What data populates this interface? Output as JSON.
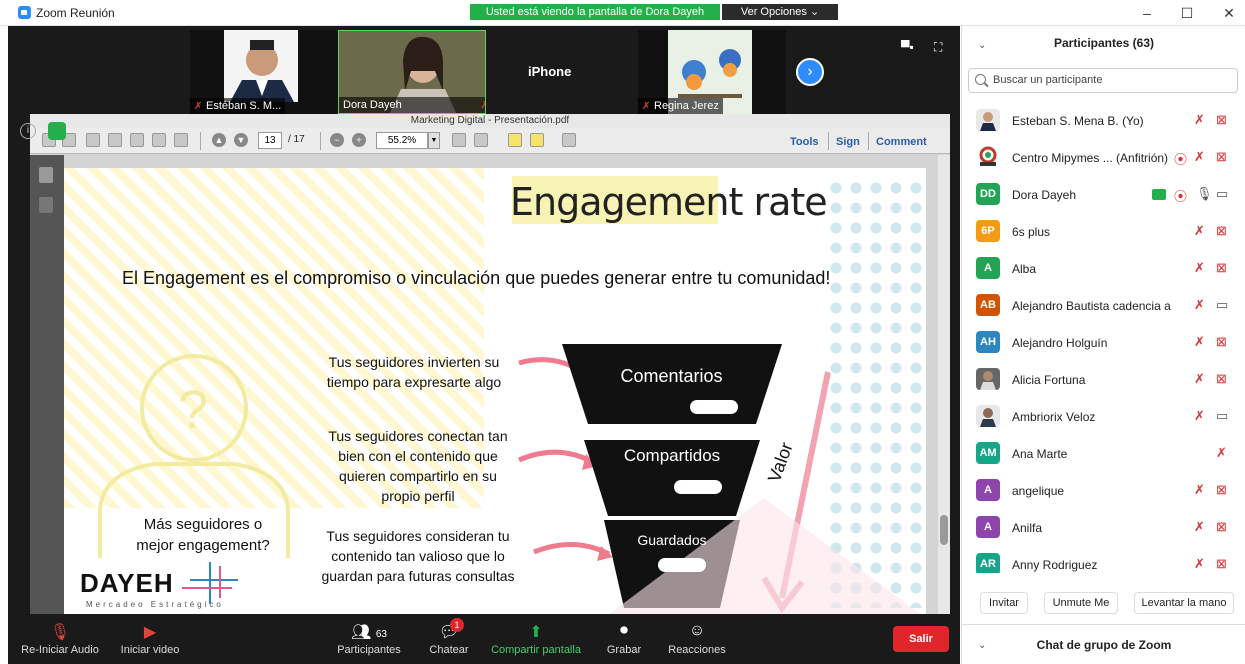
{
  "window": {
    "title": "Zoom Reunión",
    "minimize": "–",
    "maximize": "☐",
    "close": "✕"
  },
  "banner": {
    "text": "Usted está viendo la pantalla de Dora Dayeh",
    "view_options": "Ver Opciones ⌄"
  },
  "video_strip": {
    "tiles": [
      {
        "name": "Estéban S. M..."
      },
      {
        "name": "Dora Dayeh"
      },
      {
        "name": "iPhone"
      },
      {
        "name": "Regina Jerez"
      }
    ]
  },
  "pdf": {
    "title": "Marketing Digital - Presentación.pdf",
    "page": "13",
    "page_total": "/ 17",
    "zoom": "55.2%",
    "tools": "Tools",
    "sign": "Sign",
    "comment": "Comment"
  },
  "slide": {
    "title": "Engagement rate",
    "subtitle": "El Engagement es el compromiso o vinculación que puedes generar entre tu comunidad!",
    "question": "Más seguidores o mejor engagement?",
    "para1": "Tus seguidores invierten su tiempo para expresarte algo",
    "para2": "Tus seguidores conectan tan bien con el contenido que quieren compartirlo en su propio perfil",
    "para3": "Tus seguidores consideran tu contenido tan valioso que lo guardan para futuras consultas",
    "funnel1": "Comentarios",
    "funnel2": "Compartidos",
    "funnel3": "Guardados",
    "valor": "Valor",
    "logo": "DAYEH",
    "logo_sub": "Mercadeo Estratégico"
  },
  "toolbar": {
    "audio": "Re-Iniciar Audio",
    "video": "Iniciar video",
    "participants": "Participantes",
    "participants_count": "63",
    "chat": "Chatear",
    "chat_badge": "1",
    "share": "Compartir pantalla",
    "record": "Grabar",
    "reactions": "Reacciones",
    "exit": "Salir"
  },
  "panel": {
    "header": "Participantes (63)",
    "search_placeholder": "Buscar un participante",
    "participants": [
      {
        "name": "Esteban S. Mena B. (Yo)",
        "initials": "",
        "color": "#555555"
      },
      {
        "name": "Centro Mipymes ... (Anfitrión)",
        "initials": "",
        "color": "#c0392b"
      },
      {
        "name": "Dora Dayeh",
        "initials": "DD",
        "color": "#23a455"
      },
      {
        "name": "6s plus",
        "initials": "6P",
        "color": "#f39c12"
      },
      {
        "name": "Alba",
        "initials": "A",
        "color": "#23a455"
      },
      {
        "name": "Alejandro Bautista cadencia a",
        "initials": "AB",
        "color": "#d35400"
      },
      {
        "name": "Alejandro Holguín",
        "initials": "AH",
        "color": "#2e86c1"
      },
      {
        "name": "Alicia Fortuna",
        "initials": "",
        "color": "#666666"
      },
      {
        "name": "Ambriorix Veloz",
        "initials": "",
        "color": "#777777"
      },
      {
        "name": "Ana Marte",
        "initials": "AM",
        "color": "#17a589"
      },
      {
        "name": "angelique",
        "initials": "A",
        "color": "#8e44ad"
      },
      {
        "name": "Anilfa",
        "initials": "A",
        "color": "#8e44ad"
      },
      {
        "name": "Anny Rodriguez",
        "initials": "AR",
        "color": "#17a589"
      }
    ],
    "invite": "Invitar",
    "unmute": "Unmute Me",
    "raise_hand": "Levantar la mano",
    "chat_header": "Chat de grupo de Zoom"
  }
}
